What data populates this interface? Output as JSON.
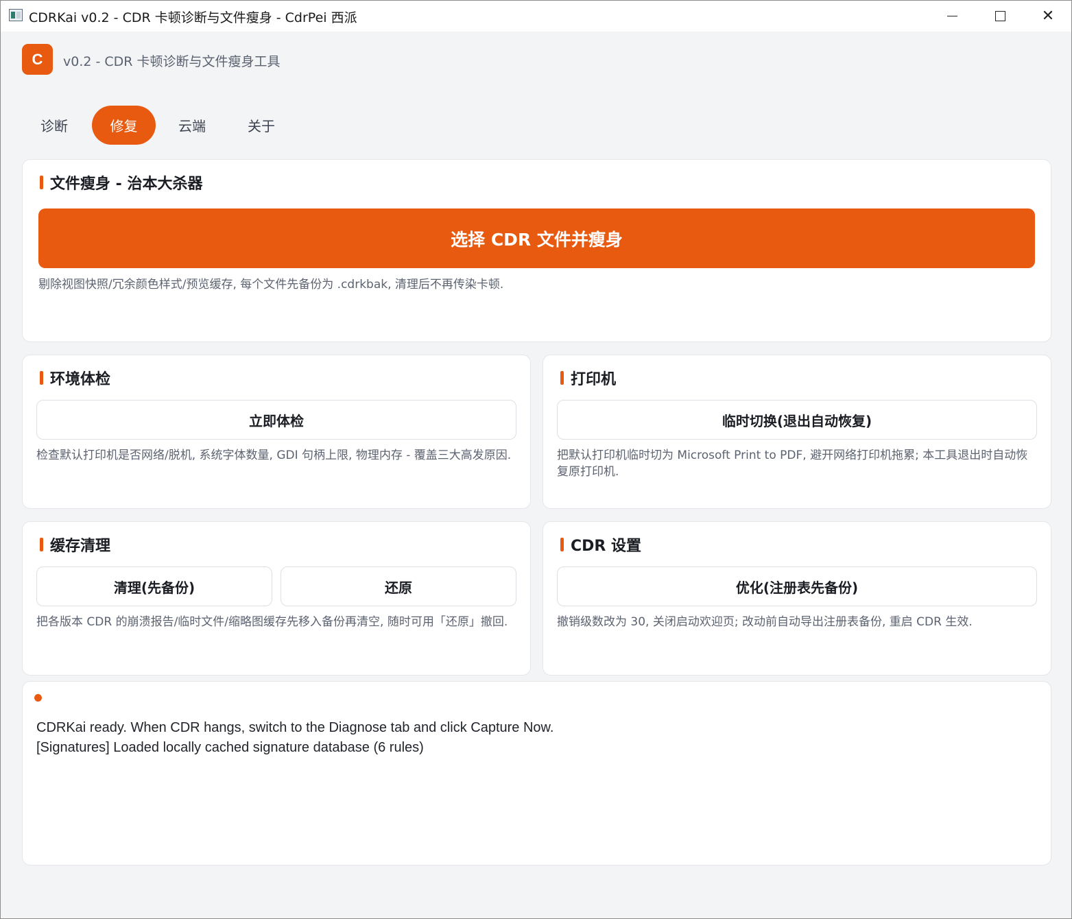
{
  "window": {
    "title": "CDRKai v0.2 - CDR 卡顿诊断与文件瘦身 - CdrPei 西派",
    "controls": {
      "minimize_icon": "minimize-icon",
      "maximize_icon": "maximize-icon",
      "close_icon": "close-icon",
      "close_glyph": "✕"
    }
  },
  "header": {
    "logo_letter": "C",
    "subtitle": "v0.2 - CDR 卡顿诊断与文件瘦身工具"
  },
  "tabs": [
    {
      "label": "诊断",
      "active": false
    },
    {
      "label": "修复",
      "active": true
    },
    {
      "label": "云端",
      "active": false
    },
    {
      "label": "关于",
      "active": false
    }
  ],
  "slim": {
    "title": "文件瘦身 - 治本大杀器",
    "button": "选择 CDR 文件并瘦身",
    "desc": "剔除视图快照/冗余颜色样式/预览缓存, 每个文件先备份为 .cdrkbak, 清理后不再传染卡顿."
  },
  "env": {
    "title": "环境体检",
    "button": "立即体检",
    "desc": "检查默认打印机是否网络/脱机, 系统字体数量, GDI 句柄上限, 物理内存 - 覆盖三大高发原因."
  },
  "printer": {
    "title": "打印机",
    "button": "临时切换(退出自动恢复)",
    "desc": "把默认打印机临时切为 Microsoft Print to PDF, 避开网络打印机拖累; 本工具退出时自动恢复原打印机."
  },
  "cache": {
    "title": "缓存清理",
    "clean_button": "清理(先备份)",
    "restore_button": "还原",
    "desc": "把各版本 CDR 的崩溃报告/临时文件/缩略图缓存先移入备份再清空, 随时可用「还原」撤回."
  },
  "cdr_settings": {
    "title": "CDR 设置",
    "button": "优化(注册表先备份)",
    "desc": "撤销级数改为 30, 关闭启动欢迎页; 改动前自动导出注册表备份, 重启 CDR 生效."
  },
  "log": {
    "lines": [
      "CDRKai ready. When CDR hangs, switch to the Diagnose tab and click Capture Now.",
      "[Signatures] Loaded locally cached signature database (6 rules)"
    ]
  },
  "colors": {
    "accent": "#e85a10",
    "background": "#f3f4f6",
    "card": "#ffffff"
  }
}
